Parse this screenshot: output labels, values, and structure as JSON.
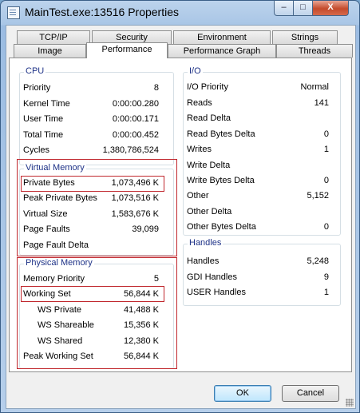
{
  "window": {
    "title": "MainTest.exe:13516 Properties",
    "min_label": "–",
    "max_label": "□",
    "close_label": "X"
  },
  "tabs_row1": [
    {
      "label": "TCP/IP"
    },
    {
      "label": "Security"
    },
    {
      "label": "Environment"
    },
    {
      "label": "Strings"
    }
  ],
  "tabs_row2": [
    {
      "label": "Image"
    },
    {
      "label": "Performance",
      "selected": true
    },
    {
      "label": "Performance Graph"
    },
    {
      "label": "Threads"
    }
  ],
  "cpu": {
    "title": "CPU",
    "rows": [
      {
        "label": "Priority",
        "value": "8"
      },
      {
        "label": "Kernel Time",
        "value": "0:00:00.280"
      },
      {
        "label": "User Time",
        "value": "0:00:00.171"
      },
      {
        "label": "Total Time",
        "value": "0:00:00.452"
      },
      {
        "label": "Cycles",
        "value": "1,380,786,524"
      }
    ]
  },
  "virtual_memory": {
    "title": "Virtual Memory",
    "rows": [
      {
        "label": "Private Bytes",
        "value": "1,073,496 K"
      },
      {
        "label": "Peak Private Bytes",
        "value": "1,073,516 K"
      },
      {
        "label": "Virtual Size",
        "value": "1,583,676 K"
      },
      {
        "label": "Page Faults",
        "value": "39,099"
      },
      {
        "label": "Page Fault Delta",
        "value": ""
      }
    ]
  },
  "physical_memory": {
    "title": "Physical Memory",
    "rows": [
      {
        "label": "Memory Priority",
        "value": "5"
      },
      {
        "label": "Working Set",
        "value": "56,844 K"
      },
      {
        "label": "WS Private",
        "value": "41,488 K"
      },
      {
        "label": "WS Shareable",
        "value": "15,356 K"
      },
      {
        "label": "WS Shared",
        "value": "12,380 K"
      },
      {
        "label": "Peak Working Set",
        "value": "56,844 K"
      }
    ]
  },
  "io": {
    "title": "I/O",
    "rows": [
      {
        "label": "I/O Priority",
        "value": "Normal"
      },
      {
        "label": "Reads",
        "value": "141"
      },
      {
        "label": "Read Delta",
        "value": ""
      },
      {
        "label": "Read Bytes Delta",
        "value": "0"
      },
      {
        "label": "Writes",
        "value": "1"
      },
      {
        "label": "Write Delta",
        "value": ""
      },
      {
        "label": "Write Bytes Delta",
        "value": "0"
      },
      {
        "label": "Other",
        "value": "5,152"
      },
      {
        "label": "Other Delta",
        "value": ""
      },
      {
        "label": "Other Bytes Delta",
        "value": "0"
      }
    ]
  },
  "handles": {
    "title": "Handles",
    "rows": [
      {
        "label": "Handles",
        "value": "5,248"
      },
      {
        "label": "GDI Handles",
        "value": "9"
      },
      {
        "label": "USER Handles",
        "value": "1"
      }
    ]
  },
  "buttons": {
    "ok": "OK",
    "cancel": "Cancel"
  },
  "colors": {
    "group_title": "#1e3287",
    "highlight_box": "#c0272d"
  }
}
